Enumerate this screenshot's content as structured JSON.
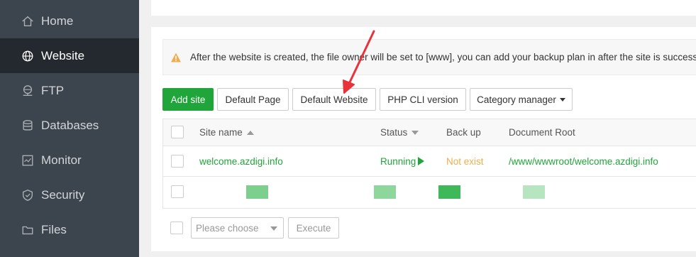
{
  "sidebar": {
    "items": [
      {
        "label": "Home",
        "icon": "home-icon"
      },
      {
        "label": "Website",
        "icon": "globe-icon",
        "active": true
      },
      {
        "label": "FTP",
        "icon": "ftp-icon"
      },
      {
        "label": "Databases",
        "icon": "database-icon"
      },
      {
        "label": "Monitor",
        "icon": "monitor-icon"
      },
      {
        "label": "Security",
        "icon": "shield-icon"
      },
      {
        "label": "Files",
        "icon": "folder-icon"
      }
    ]
  },
  "alert": {
    "text": "After the website is created, the file owner will be set to [www], you can add your backup plan in after the site is successfully"
  },
  "toolbar": {
    "add_site": "Add site",
    "default_page": "Default Page",
    "default_website": "Default Website",
    "php_cli": "PHP CLI version",
    "category_manager": "Category manager"
  },
  "table": {
    "headers": {
      "site_name": "Site name",
      "status": "Status",
      "backup": "Back up",
      "document_root": "Document Root"
    },
    "rows": [
      {
        "site_name": "welcome.azdigi.info",
        "status": "Running",
        "backup": "Not exist",
        "document_root": "/www/wwwroot/welcome.azdigi.info"
      }
    ]
  },
  "footer": {
    "select_placeholder": "Please choose",
    "execute": "Execute"
  },
  "colors": {
    "sidebar_bg": "#3c444d",
    "sidebar_active": "#23292f",
    "accent_green": "#20a53a",
    "warning_orange": "#f0ad4e",
    "annotation_red": "#e8333a"
  }
}
